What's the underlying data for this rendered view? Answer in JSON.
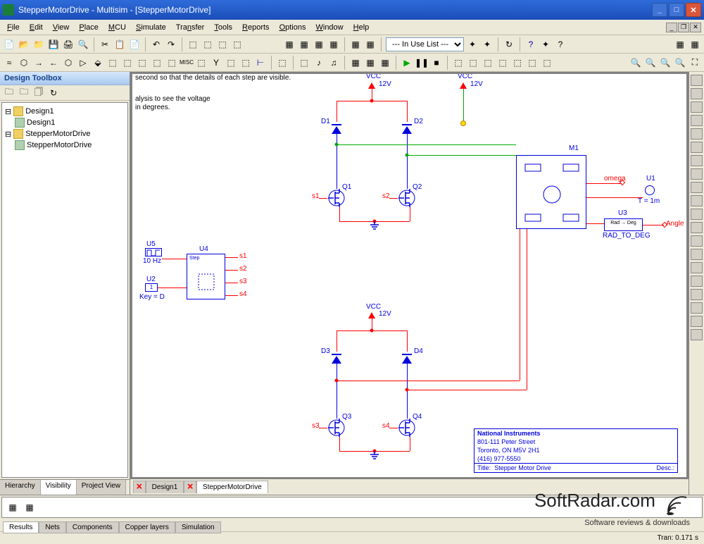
{
  "window": {
    "title": "StepperMotorDrive - Multisim - [StepperMotorDrive]"
  },
  "menus": [
    "File",
    "Edit",
    "View",
    "Place",
    "MCU",
    "Simulate",
    "Transfer",
    "Tools",
    "Reports",
    "Options",
    "Window",
    "Help"
  ],
  "toolbar_combo": "--- In Use List ---",
  "sidebar": {
    "title": "Design Toolbox",
    "tree": {
      "root1": "Design1",
      "child1": "Design1",
      "root2": "StepperMotorDrive",
      "child2": "StepperMotorDrive"
    },
    "tabs": [
      "Hierarchy",
      "Visibility",
      "Project View"
    ]
  },
  "doc_tabs": [
    "Design1",
    "StepperMotorDrive"
  ],
  "canvas": {
    "note1": "second so that the details of each step are visible.",
    "note2a": "alysis to see the voltage",
    "note2b": "in degrees.",
    "vcc": "VCC",
    "v12": "12V",
    "D1": "D1",
    "D2": "D2",
    "D3": "D3",
    "D4": "D4",
    "Q1": "Q1",
    "Q2": "Q2",
    "Q3": "Q3",
    "Q4": "Q4",
    "s1": "s1",
    "s2": "s2",
    "s3": "s3",
    "s4": "s4",
    "M1": "M1",
    "omega": "omega",
    "Angle": "Angle",
    "U1": "U1",
    "U1sub": "T = 1m",
    "U3": "U3",
    "U3sub": "RAD_TO_DEG",
    "U4": "U4",
    "U5": "U5",
    "U5sub": "10 Hz",
    "U2": "U2",
    "U2sub": "Key = D",
    "tb_company": "National Instruments",
    "tb_addr1": "801-111 Peter Street",
    "tb_addr2": "Toronto, ON M5V 2H1",
    "tb_phone": "(416) 977-5550",
    "tb_title_lbl": "Title:",
    "tb_title": "Stepper Motor Drive",
    "tb_desc_lbl": "Desc.:"
  },
  "bottom_tabs": [
    "Results",
    "Nets",
    "Components",
    "Copper layers",
    "Simulation"
  ],
  "status": "Tran: 0.171 s",
  "watermark": {
    "big": "SoftRadar.com",
    "small": "Software reviews & downloads"
  }
}
